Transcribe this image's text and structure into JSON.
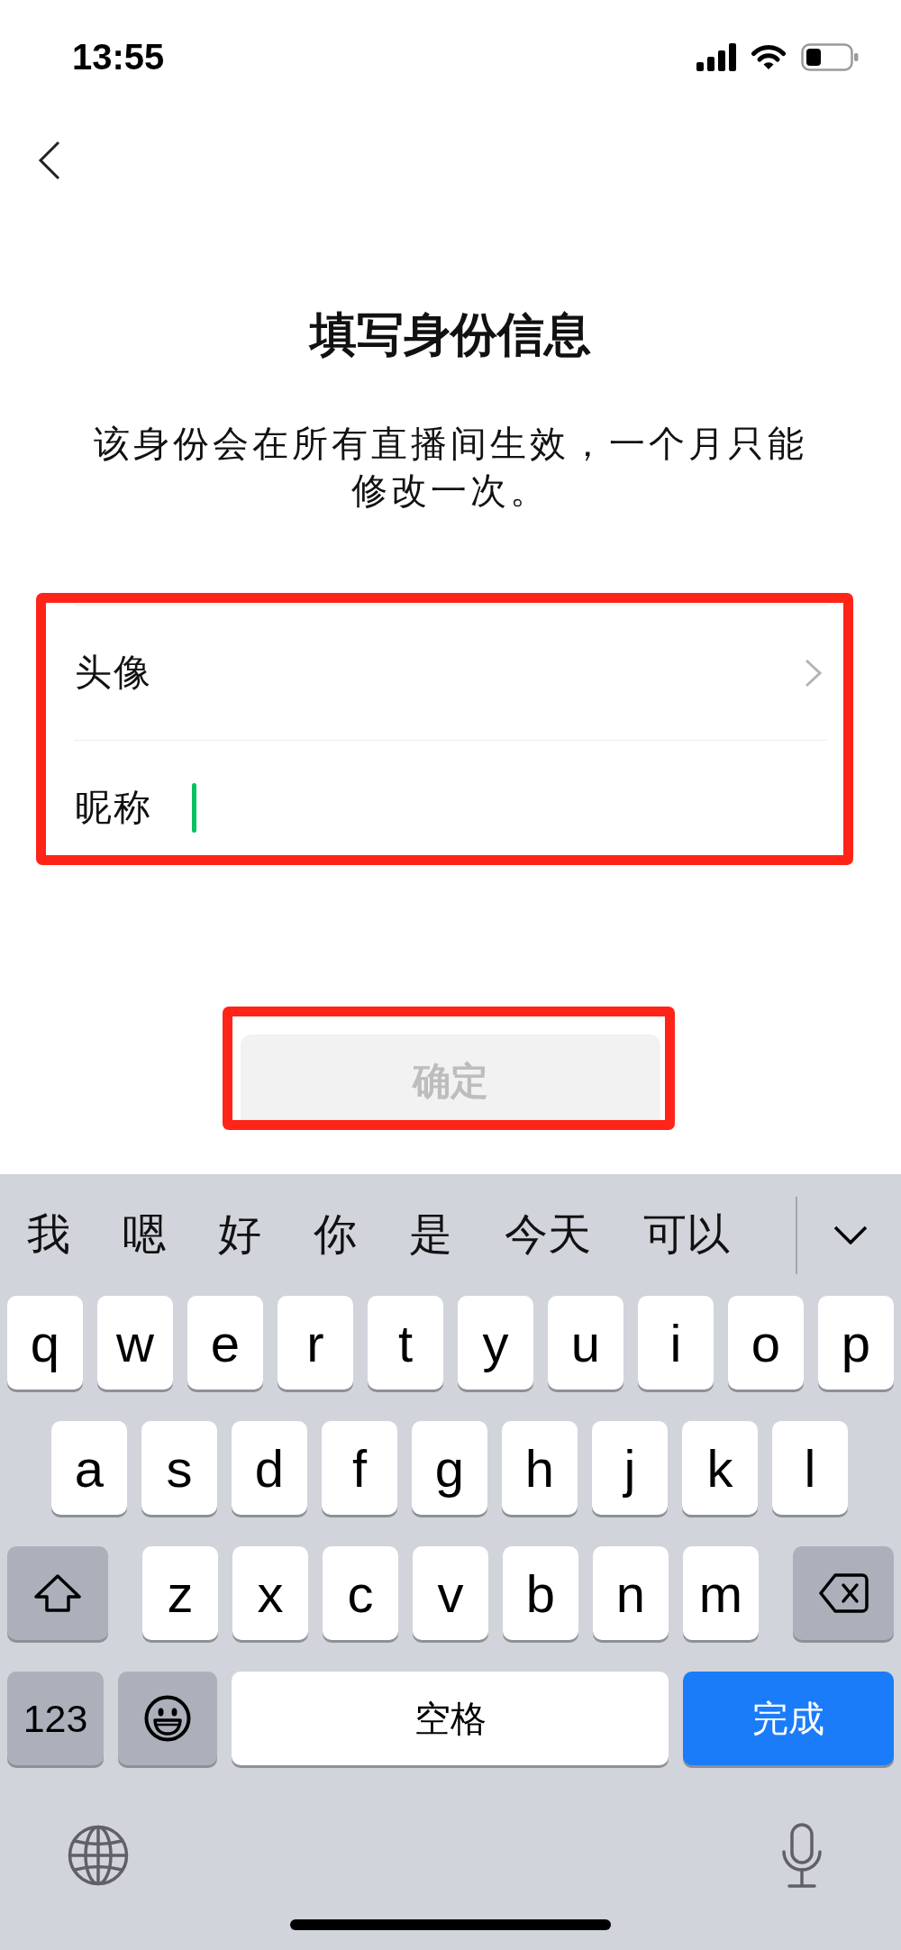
{
  "status_bar": {
    "time": "13:55"
  },
  "title": "填写身份信息",
  "description": "该身份会在所有直播间生效，一个月只能修改一次。",
  "form": {
    "highlighted": true,
    "rows": [
      {
        "kind": "link",
        "label": "头像"
      },
      {
        "kind": "input",
        "label": "昵称",
        "focused": true
      }
    ]
  },
  "confirm_button": {
    "label": "确定",
    "disabled": true,
    "highlighted": true
  },
  "keyboard": {
    "candidates": [
      "我",
      "嗯",
      "好",
      "你",
      "是",
      "今天",
      "可以"
    ],
    "rows": [
      [
        "q",
        "w",
        "e",
        "r",
        "t",
        "y",
        "u",
        "i",
        "o",
        "p"
      ],
      [
        "a",
        "s",
        "d",
        "f",
        "g",
        "h",
        "j",
        "k",
        "l"
      ],
      [
        "z",
        "x",
        "c",
        "v",
        "b",
        "n",
        "m"
      ]
    ],
    "number_key": "123",
    "space_key": "空格",
    "return_key": "完成"
  }
}
